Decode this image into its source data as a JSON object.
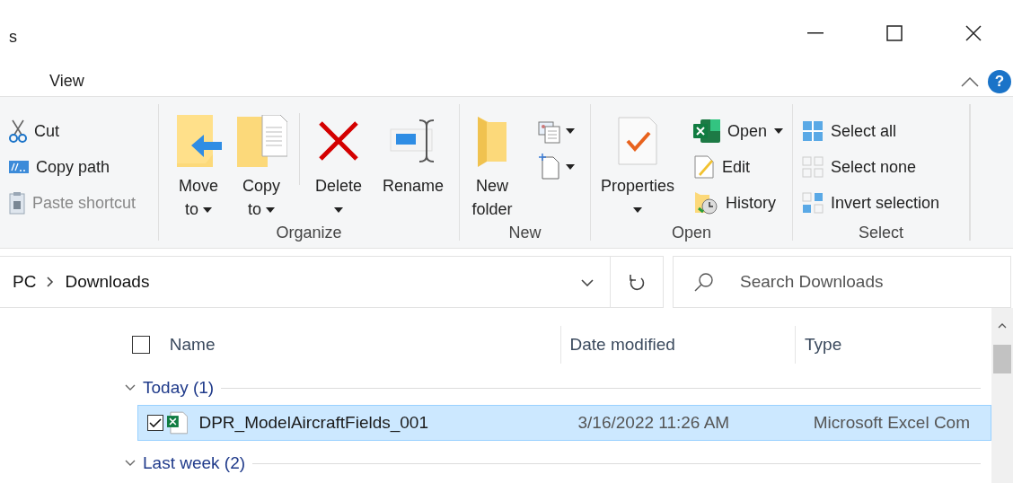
{
  "window": {
    "title": "s"
  },
  "ribbon_tabs": [
    {
      "label": "View",
      "selected": false
    }
  ],
  "help": "?",
  "ribbon_groups": [
    {
      "items": [
        {
          "label": "Cut",
          "kind": "small",
          "disabled": false
        },
        {
          "label": "Copy path",
          "kind": "small",
          "disabled": false
        },
        {
          "label": "Paste shortcut",
          "kind": "small",
          "disabled": true
        }
      ]
    },
    {
      "label": "Organize",
      "items": [
        {
          "label": "Move to",
          "kind": "large",
          "dropdown": true
        },
        {
          "label": "Copy to",
          "kind": "large",
          "dropdown": true
        },
        {
          "label": "Delete",
          "kind": "large",
          "dropdown": true
        },
        {
          "label": "Rename",
          "kind": "large"
        }
      ]
    },
    {
      "label": "New",
      "items": [
        {
          "label": "New folder",
          "kind": "large"
        },
        {
          "kind": "icon",
          "dropdown": true
        },
        {
          "kind": "icon",
          "dropdown": true
        }
      ]
    },
    {
      "label": "Open",
      "items": [
        {
          "label": "Properties",
          "kind": "large",
          "dropdown": true
        },
        {
          "label": "Open",
          "kind": "small",
          "dropdown": true,
          "disabled": false
        },
        {
          "label": "Edit",
          "kind": "small",
          "disabled": false
        },
        {
          "label": "History",
          "kind": "small",
          "disabled": false
        }
      ]
    },
    {
      "label": "Select",
      "items": [
        {
          "label": "Select all",
          "kind": "small",
          "disabled": false
        },
        {
          "label": "Select none",
          "kind": "small",
          "disabled": false
        },
        {
          "label": "Invert selection",
          "kind": "small",
          "disabled": false
        }
      ]
    }
  ],
  "address": {
    "path": [
      "PC",
      "Downloads"
    ],
    "search_placeholder": "Search Downloads"
  },
  "file_list": {
    "select_all_checked": false,
    "columns": [
      "Name",
      "Date modified",
      "Type"
    ],
    "groups": [
      {
        "label": "Today (1)",
        "expanded": true,
        "files": [
          {
            "name": "DPR_ModelAircraftFields_001",
            "date": "3/16/2022 11:26 AM",
            "type": "Microsoft Excel Com",
            "selected": true,
            "checked": true
          }
        ]
      },
      {
        "label": "Last week (2)",
        "expanded": true
      }
    ]
  }
}
